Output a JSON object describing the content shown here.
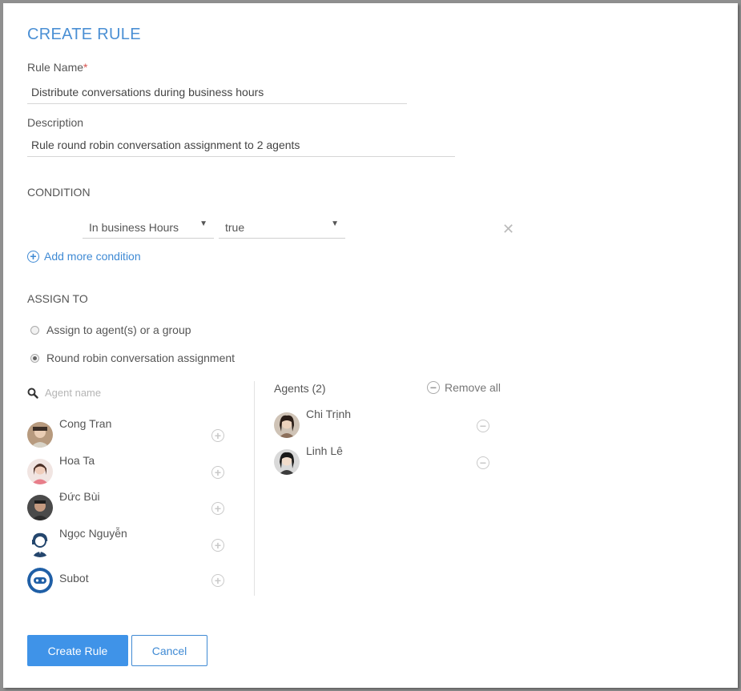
{
  "form": {
    "title": "CREATE RULE",
    "rule_name_label": "Rule Name",
    "required_mark": "*",
    "rule_name_value": "Distribute conversations during business hours",
    "description_label": "Description",
    "description_value": "Rule round robin conversation assignment to 2 agents"
  },
  "condition": {
    "heading": "CONDITION",
    "field_value": "In business Hours",
    "operand_value": "true",
    "add_more_label": "Add more condition"
  },
  "assign": {
    "heading": "ASSIGN TO",
    "option_1": "Assign to agent(s) or a group",
    "option_2": "Round robin conversation assignment",
    "selected": "option_2"
  },
  "available": {
    "search_placeholder": "Agent name",
    "agents": [
      {
        "name": "Cong Tran",
        "icon": "user-photo"
      },
      {
        "name": "Hoa Ta",
        "icon": "user-photo"
      },
      {
        "name": "Đức Bùi",
        "icon": "user-photo"
      },
      {
        "name": "Ngọc Nguyễn",
        "icon": "support-agent-icon"
      },
      {
        "name": "Subot",
        "icon": "bot-icon"
      }
    ]
  },
  "assigned": {
    "heading": "Agents (2)",
    "remove_all_label": "Remove all",
    "agents": [
      {
        "name": "Chi Trịnh"
      },
      {
        "name": "Linh Lê"
      }
    ]
  },
  "actions": {
    "create_label": "Create Rule",
    "cancel_label": "Cancel"
  },
  "colors": {
    "accent": "#3f93e8",
    "title": "#4a8fd4",
    "required": "#d9534f"
  }
}
